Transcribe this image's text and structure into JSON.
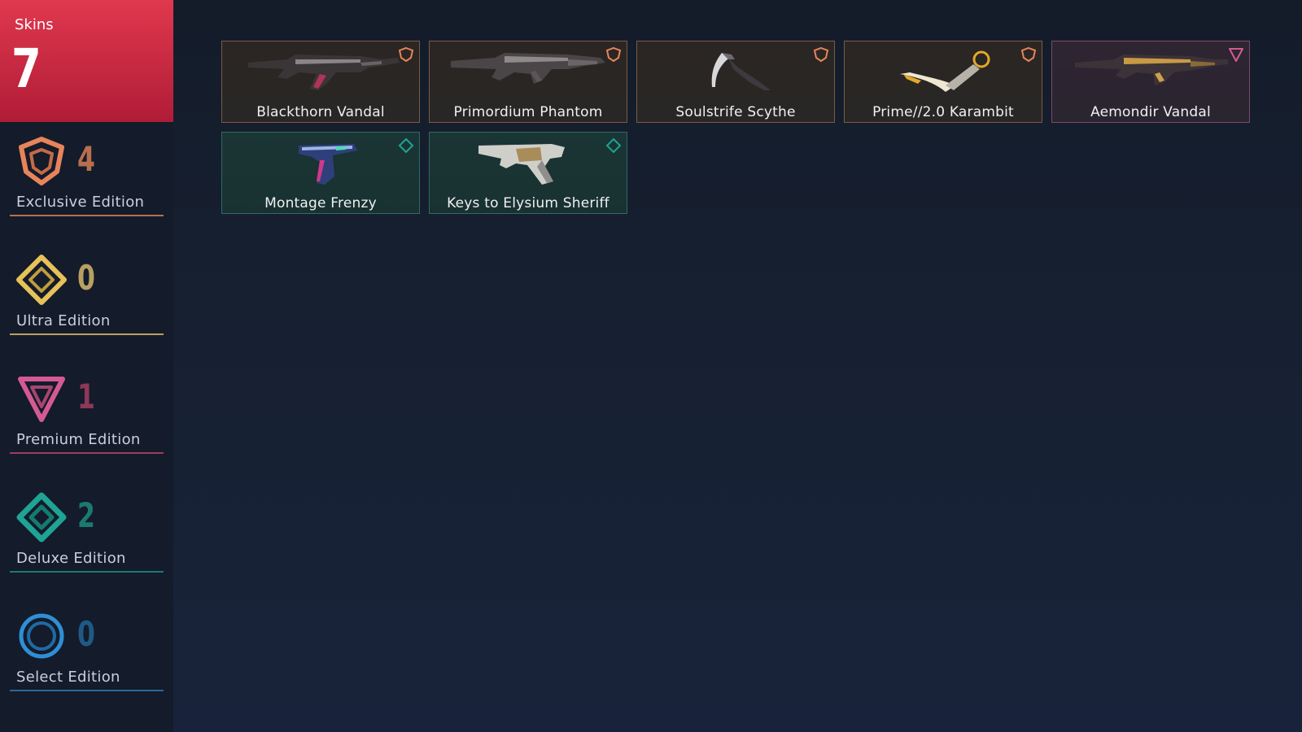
{
  "summary": {
    "label": "Skins",
    "count": "7",
    "color": "#d42b45"
  },
  "tiers": [
    {
      "name": "Exclusive Edition",
      "count": "4",
      "color": "#e8845a",
      "icon": "exclusive-edition-icon"
    },
    {
      "name": "Ultra Edition",
      "count": "0",
      "color": "#e6c259",
      "icon": "ultra-edition-icon"
    },
    {
      "name": "Premium Edition",
      "count": "1",
      "color": "#d45a93",
      "icon": "premium-edition-icon"
    },
    {
      "name": "Deluxe Edition",
      "count": "2",
      "color": "#1fa394",
      "icon": "deluxe-edition-icon"
    },
    {
      "name": "Select Edition",
      "count": "0",
      "color": "#2e8fd6",
      "icon": "select-edition-icon"
    }
  ],
  "skins": [
    {
      "name": "Blackthorn Vandal",
      "tier": "exclusive",
      "icon": "rifle-icon"
    },
    {
      "name": "Primordium Phantom",
      "tier": "exclusive",
      "icon": "rifle-icon"
    },
    {
      "name": "Soulstrife Scythe",
      "tier": "exclusive",
      "icon": "scythe-icon"
    },
    {
      "name": "Prime//2.0 Karambit",
      "tier": "exclusive",
      "icon": "karambit-icon"
    },
    {
      "name": "Aemondir Vandal",
      "tier": "premium",
      "icon": "rifle-icon"
    },
    {
      "name": "Montage Frenzy",
      "tier": "deluxe",
      "icon": "pistol-icon"
    },
    {
      "name": "Keys to Elysium Sheriff",
      "tier": "deluxe",
      "icon": "revolver-icon"
    }
  ]
}
